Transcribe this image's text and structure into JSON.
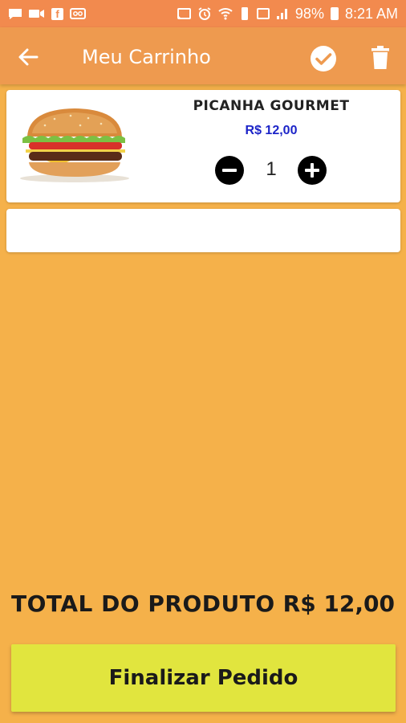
{
  "status_bar": {
    "battery": "98%",
    "time": "8:21 AM"
  },
  "app_bar": {
    "title": "Meu Carrinho"
  },
  "cart": {
    "items": [
      {
        "name": "PICANHA GOURMET",
        "price": "R$ 12,00",
        "quantity": "1"
      }
    ]
  },
  "total": {
    "label": "TOTAL DO PRODUTO",
    "value": "R$ 12,00"
  },
  "actions": {
    "finalize_label": "Finalizar Pedido"
  },
  "colors": {
    "status_bar": "#F28A4E",
    "app_bar": "#EE9A4F",
    "background": "#F5B14A",
    "price": "#1C24C8",
    "finalize_button": "#E1E53E"
  }
}
